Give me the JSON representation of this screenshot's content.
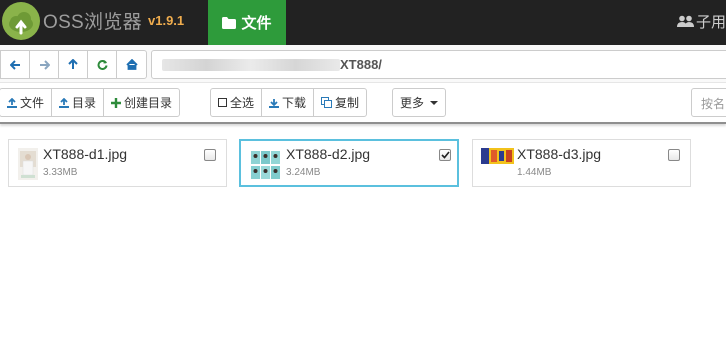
{
  "app": {
    "name": "OSS浏览器",
    "version": "v1.9.1"
  },
  "nav": {
    "files_tab": "文件",
    "user_label": "子用"
  },
  "address": {
    "path": "XT888/"
  },
  "toolbar": {
    "upload_file": "文件",
    "upload_folder": "目录",
    "create_folder": "创建目录",
    "select_all": "全选",
    "download": "下载",
    "copy": "复制",
    "more": "更多",
    "search_placeholder": "按名"
  },
  "files": [
    {
      "name": "XT888-d1.jpg",
      "size": "3.33MB",
      "checked": false
    },
    {
      "name": "XT888-d2.jpg",
      "size": "3.24MB",
      "checked": true
    },
    {
      "name": "XT888-d3.jpg",
      "size": "1.44MB",
      "checked": false
    }
  ],
  "colors": {
    "topbar": "#222222",
    "active_tab": "#2e9b3b",
    "version": "#f0ad4e",
    "selected_border": "#5bc0de"
  }
}
